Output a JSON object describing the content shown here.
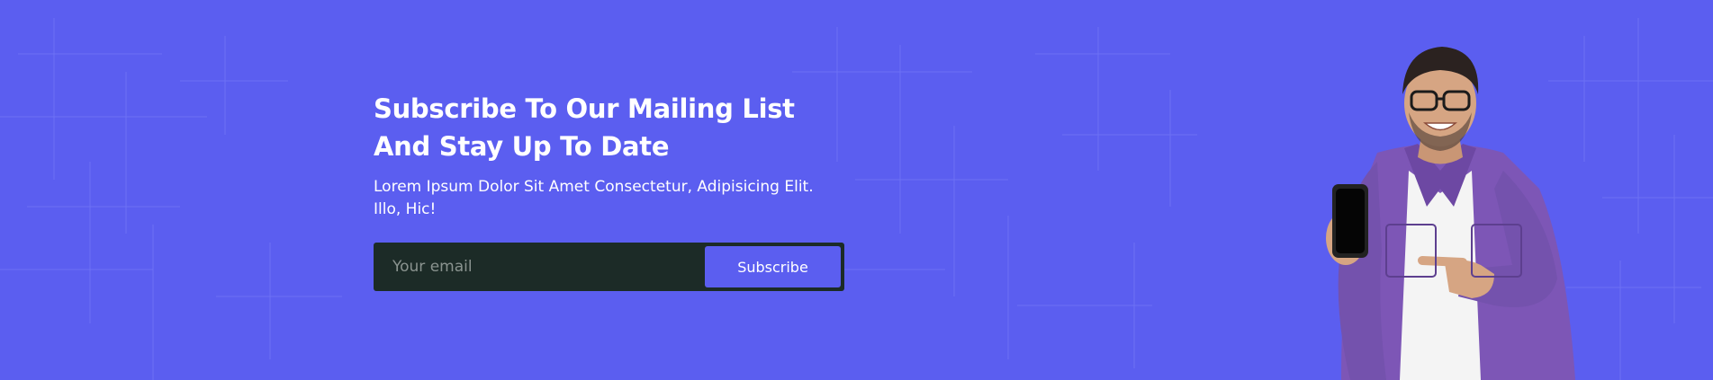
{
  "newsletter": {
    "heading": "Subscribe To Our Mailing List And Stay Up To Date",
    "description": "Lorem Ipsum Dolor Sit Amet Consectetur, Adipisicing Elit. Illo, Hic!",
    "email_placeholder": "Your email",
    "button_label": "Subscribe"
  },
  "colors": {
    "background": "#5b5ef0",
    "form_background": "#1c2b27",
    "button": "#5b5ef0",
    "text": "#ffffff"
  },
  "illustration": {
    "icon": "person-holding-phone-illustration"
  }
}
